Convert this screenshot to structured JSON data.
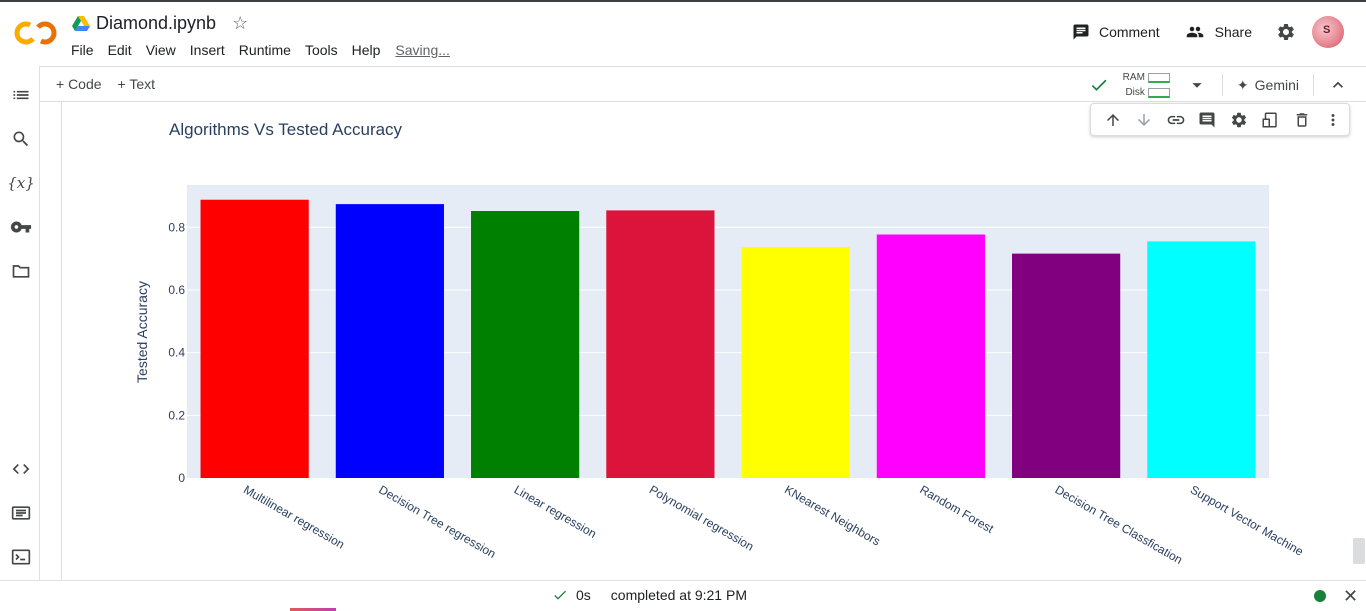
{
  "app": {
    "title": "Diamond.ipynb",
    "menu": [
      "File",
      "Edit",
      "View",
      "Insert",
      "Runtime",
      "Tools",
      "Help"
    ],
    "saving_label": "Saving...",
    "comment_label": "Comment",
    "share_label": "Share",
    "avatar_letter": "S"
  },
  "toolbar": {
    "add_code": "+ Code",
    "add_text": "+ Text",
    "ram_label": "RAM",
    "disk_label": "Disk",
    "gemini_label": "Gemini"
  },
  "sidebar": {
    "items": [
      "toc-icon",
      "search-icon",
      "variables-icon",
      "key-icon",
      "folder-icon",
      "code-snippets-icon",
      "command-palette-icon",
      "terminal-icon"
    ]
  },
  "status": {
    "duration": "0s",
    "completed": "completed at 9:21 PM"
  },
  "colors": {
    "plot_bg": "#e5ecf6",
    "accent_green": "#188038"
  },
  "chart_data": {
    "type": "bar",
    "title": "Algorithms Vs Tested Accuracy",
    "xlabel": "",
    "ylabel": "Tested Accuracy",
    "categories": [
      "Multilinear regression",
      "Decision Tree regression",
      "Linear regression",
      "Polynomial regression",
      "KNearest Neighbors",
      "Random Forest",
      "Decision Tree Classfication",
      "Support Vector Machine"
    ],
    "values": [
      0.888,
      0.874,
      0.852,
      0.854,
      0.737,
      0.777,
      0.716,
      0.755
    ],
    "colors": [
      "#ff0000",
      "#0000ff",
      "#008000",
      "#dc143c",
      "#ffff00",
      "#ff00ff",
      "#800080",
      "#00ffff"
    ],
    "ylim": [
      0,
      0.935
    ],
    "yticks": [
      0,
      0.2,
      0.4,
      0.6,
      0.8
    ],
    "ytick_labels": [
      "0",
      "0.2",
      "0.4",
      "0.6",
      "0.8"
    ],
    "grid": true
  }
}
